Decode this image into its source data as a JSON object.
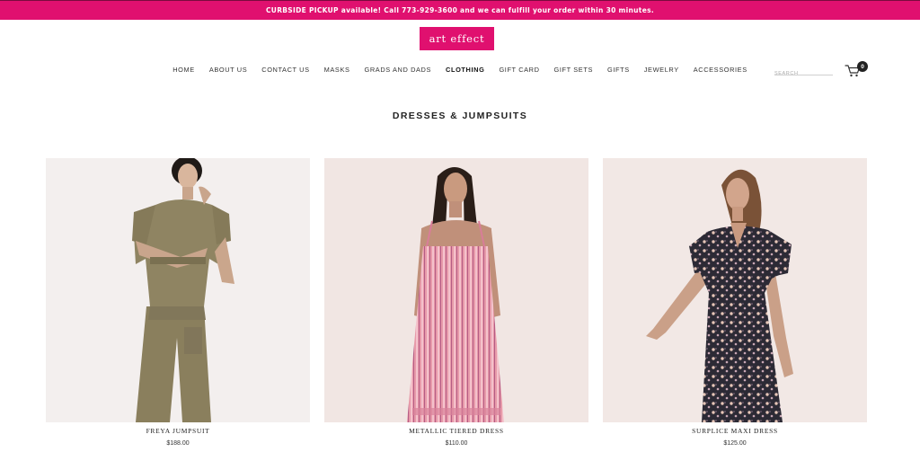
{
  "promo": {
    "text": "CURBSIDE PICKUP available! Call 773-929-3600 and we can fulfill your order within 30 minutes."
  },
  "brand": {
    "logo_text": "art effect",
    "accent": "#e0106f"
  },
  "nav": {
    "items": [
      {
        "label": "HOME"
      },
      {
        "label": "ABOUT US"
      },
      {
        "label": "CONTACT US"
      },
      {
        "label": "MASKS"
      },
      {
        "label": "GRADS AND DADS"
      },
      {
        "label": "CLOTHING",
        "active": true
      },
      {
        "label": "GIFT CARD"
      },
      {
        "label": "GIFT SETS"
      },
      {
        "label": "GIFTS"
      },
      {
        "label": "JEWELRY"
      },
      {
        "label": "ACCESSORIES"
      }
    ]
  },
  "search": {
    "placeholder": "SEARCH"
  },
  "cart": {
    "icon": "cart-icon",
    "count": "0"
  },
  "page": {
    "title": "DRESSES & JUMPSUITS"
  },
  "products": [
    {
      "name": "FREYA JUMPSUIT",
      "price": "$188.00"
    },
    {
      "name": "METALLIC TIERED DRESS",
      "price": "$110.00"
    },
    {
      "name": "SURPLICE MAXI DRESS",
      "price": "$125.00"
    }
  ]
}
